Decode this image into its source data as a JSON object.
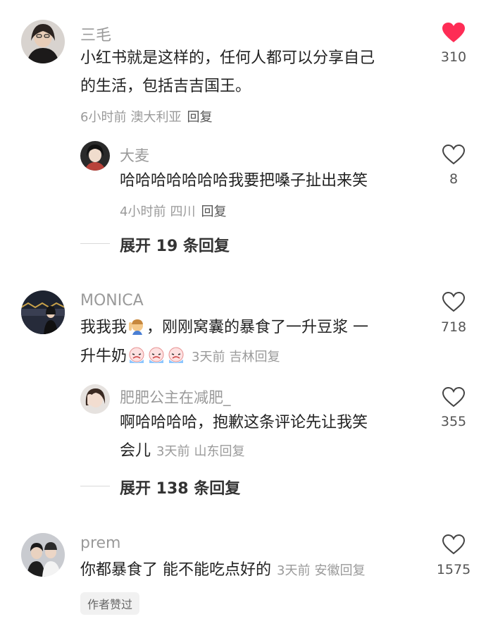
{
  "accent_color": "#fe2c55",
  "comments": [
    {
      "username": "三毛",
      "text_lines": [
        "小红书就是这样的，任何人都可以分享自己",
        "的生活，包括吉吉国王。"
      ],
      "time": "6小时前",
      "location": "澳大利亚",
      "reply_label": "回复",
      "likes": "310",
      "liked": true
    },
    {
      "username": "大麦",
      "text": "哈哈哈哈哈哈哈我要把嗓子扯出来笑",
      "time": "4小时前",
      "location": "四川",
      "reply_label": "回复",
      "likes": "8",
      "liked": false
    },
    {
      "expand_label": "展开 19 条回复"
    },
    {
      "username": "MONICA",
      "text_line1_a": "我我我",
      "text_line1_b": "，刚刚窝囊的暴食了一升豆浆 一",
      "text_line2": "升牛奶",
      "time": "3天前",
      "location": "吉林",
      "reply_label": "回复",
      "likes": "718",
      "liked": false,
      "emoji_icons": [
        "person-raising-hand-emoji",
        "crying-face-emoji",
        "crying-face-emoji",
        "crying-face-emoji"
      ]
    },
    {
      "username": "肥肥公主在减肥_",
      "text_line1": "啊哈哈哈哈，抱歉这条评论先让我笑",
      "text_line2": "会儿",
      "time": "3天前",
      "location": "山东",
      "reply_label": "回复",
      "likes": "355",
      "liked": false
    },
    {
      "expand_label": "展开 138 条回复"
    },
    {
      "username": "prem",
      "text": "你都暴食了 能不能吃点好的",
      "time": "3天前",
      "location": "安徽",
      "reply_label": "回复",
      "likes": "1575",
      "liked": false,
      "badge": "作者赞过"
    }
  ]
}
